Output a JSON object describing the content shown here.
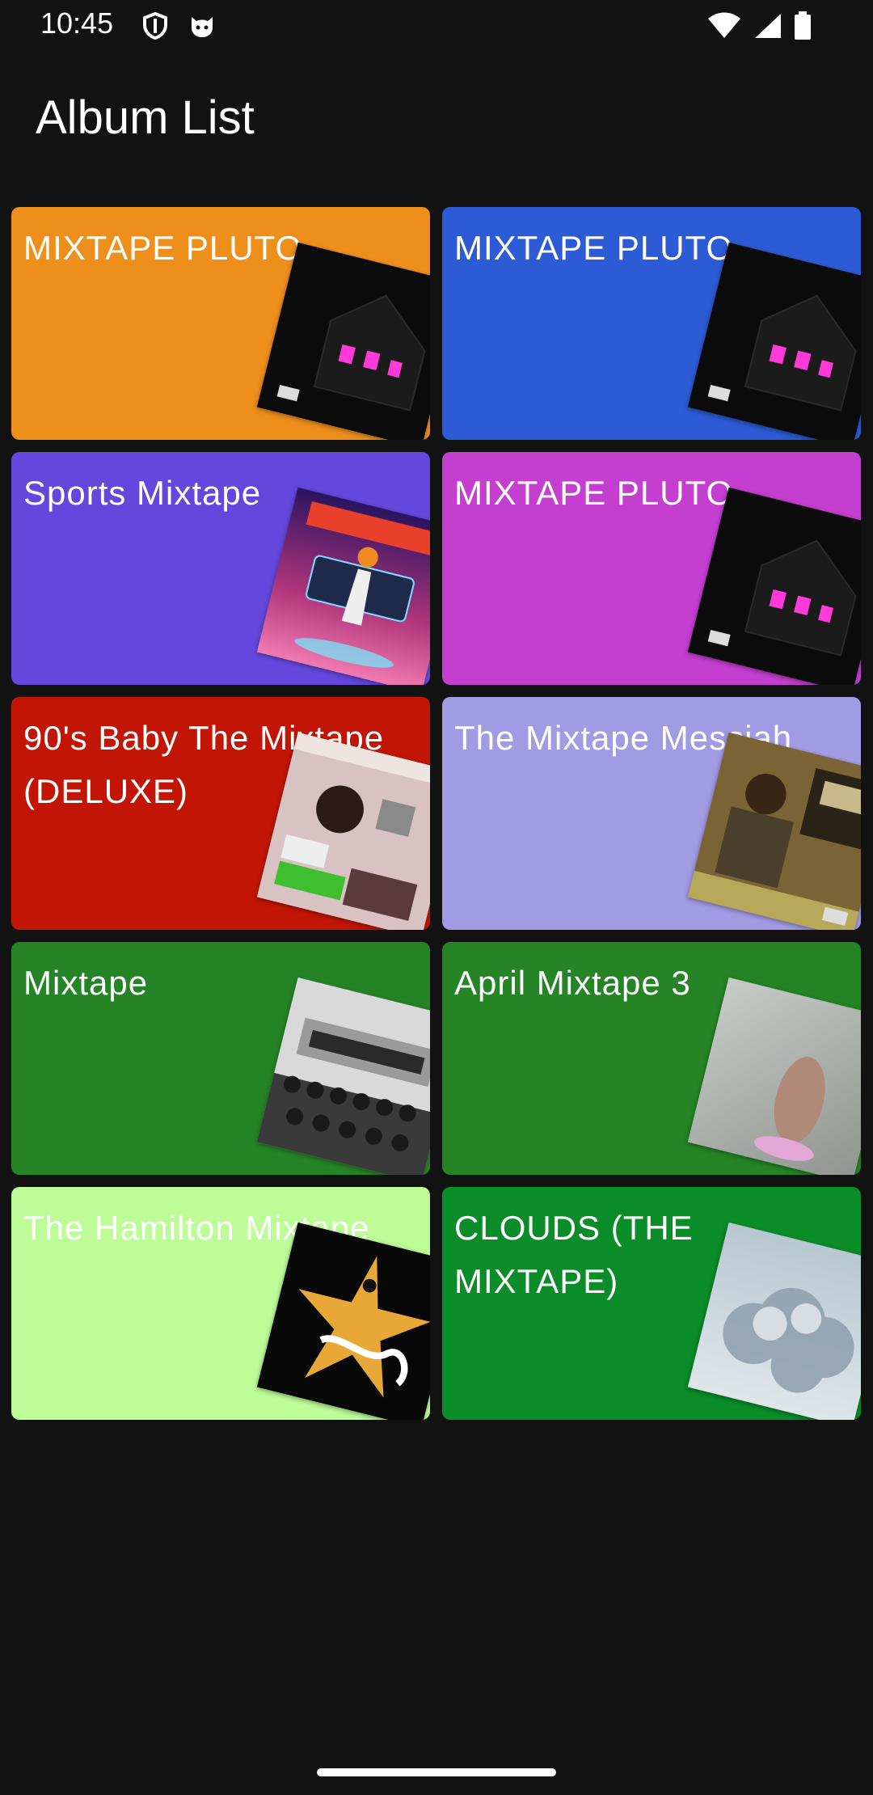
{
  "status_bar": {
    "time": "10:45",
    "left_icons": [
      "shield-icon",
      "cat-face-icon"
    ],
    "right_icons": [
      "wifi-icon",
      "cell-signal-icon",
      "battery-icon"
    ]
  },
  "app": {
    "title": "Album List"
  },
  "albums": [
    {
      "title": "MIXTAPE PLUTO",
      "color": "#EE8F1C",
      "art": "house-cover-art"
    },
    {
      "title": "MIXTAPE PLUTO",
      "color": "#2D5BD6",
      "art": "house-cover-art"
    },
    {
      "title": "Sports Mixtape",
      "color": "#6447DC",
      "art": "sports-mixtape-cover-art"
    },
    {
      "title": "MIXTAPE PLUTO",
      "color": "#C43ED0",
      "art": "house-cover-art"
    },
    {
      "title": "90's Baby The Mixtape (DELUXE)",
      "color": "#C21505",
      "art": "90s-baby-cover-art"
    },
    {
      "title": "The Mixtape Messiah",
      "color": "#A19BE3",
      "art": "mixtape-messiah-cover-art"
    },
    {
      "title": "Mixtape",
      "color": "#258425",
      "art": "mixtape-group-cover-art"
    },
    {
      "title": "April Mixtape 3",
      "color": "#258425",
      "art": "april-mixtape-cover-art"
    },
    {
      "title": "The Hamilton Mixtape",
      "color": "#BEFC98",
      "art": "hamilton-cover-art"
    },
    {
      "title": "CLOUDS (THE MIXTAPE)",
      "color": "#0A8C28",
      "art": "clouds-cover-art"
    }
  ]
}
